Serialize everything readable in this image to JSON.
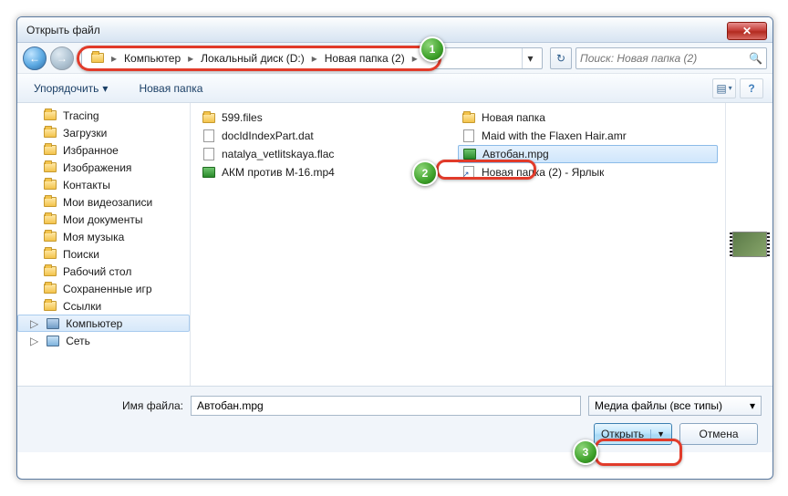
{
  "window": {
    "title": "Открыть файл"
  },
  "breadcrumb": {
    "segments": [
      "Компьютер",
      "Локальный диск (D:)",
      "Новая папка (2)"
    ]
  },
  "search": {
    "placeholder": "Поиск: Новая папка (2)"
  },
  "toolbar": {
    "organize": "Упорядочить",
    "newfolder": "Новая папка"
  },
  "sidebar": {
    "items": [
      {
        "label": "Tracing",
        "icon": "folder"
      },
      {
        "label": "Загрузки",
        "icon": "folder"
      },
      {
        "label": "Избранное",
        "icon": "folder"
      },
      {
        "label": "Изображения",
        "icon": "folder"
      },
      {
        "label": "Контакты",
        "icon": "folder"
      },
      {
        "label": "Мои видеозаписи",
        "icon": "folder"
      },
      {
        "label": "Мои документы",
        "icon": "folder"
      },
      {
        "label": "Моя музыка",
        "icon": "folder"
      },
      {
        "label": "Поиски",
        "icon": "folder"
      },
      {
        "label": "Рабочий стол",
        "icon": "folder"
      },
      {
        "label": "Сохраненные игр",
        "icon": "folder"
      },
      {
        "label": "Ссылки",
        "icon": "folder"
      }
    ],
    "computer": "Компьютер",
    "network": "Сеть"
  },
  "files": {
    "col1": [
      {
        "label": "599.files",
        "icon": "folder"
      },
      {
        "label": "docIdIndexPart.dat",
        "icon": "file"
      },
      {
        "label": "natalya_vetlitskaya.flac",
        "icon": "file"
      },
      {
        "label": "АКМ против М-16.mp4",
        "icon": "media"
      }
    ],
    "col2": [
      {
        "label": "Новая папка",
        "icon": "folder"
      },
      {
        "label": "Maid with the Flaxen Hair.amr",
        "icon": "file"
      },
      {
        "label": "Автобан.mpg",
        "icon": "media",
        "selected": true
      },
      {
        "label": "Новая папка (2) - Ярлык",
        "icon": "link"
      }
    ]
  },
  "bottom": {
    "filename_label": "Имя файла:",
    "filename_value": "Автобан.mpg",
    "filter": "Медиа файлы (все типы)",
    "open": "Открыть",
    "cancel": "Отмена"
  },
  "callouts": {
    "n1": "1",
    "n2": "2",
    "n3": "3"
  }
}
